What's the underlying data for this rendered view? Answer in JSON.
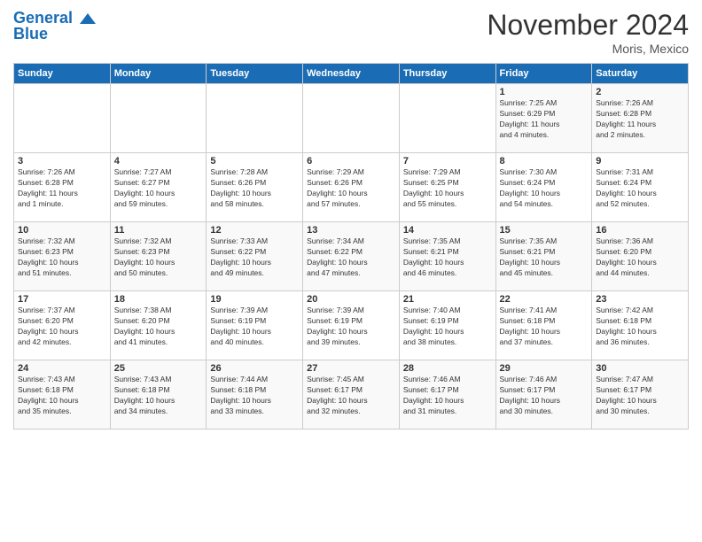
{
  "header": {
    "logo_line1": "General",
    "logo_line2": "Blue",
    "month": "November 2024",
    "location": "Moris, Mexico"
  },
  "days_of_week": [
    "Sunday",
    "Monday",
    "Tuesday",
    "Wednesday",
    "Thursday",
    "Friday",
    "Saturday"
  ],
  "weeks": [
    [
      {
        "num": "",
        "info": ""
      },
      {
        "num": "",
        "info": ""
      },
      {
        "num": "",
        "info": ""
      },
      {
        "num": "",
        "info": ""
      },
      {
        "num": "",
        "info": ""
      },
      {
        "num": "1",
        "info": "Sunrise: 7:25 AM\nSunset: 6:29 PM\nDaylight: 11 hours\nand 4 minutes."
      },
      {
        "num": "2",
        "info": "Sunrise: 7:26 AM\nSunset: 6:28 PM\nDaylight: 11 hours\nand 2 minutes."
      }
    ],
    [
      {
        "num": "3",
        "info": "Sunrise: 7:26 AM\nSunset: 6:28 PM\nDaylight: 11 hours\nand 1 minute."
      },
      {
        "num": "4",
        "info": "Sunrise: 7:27 AM\nSunset: 6:27 PM\nDaylight: 10 hours\nand 59 minutes."
      },
      {
        "num": "5",
        "info": "Sunrise: 7:28 AM\nSunset: 6:26 PM\nDaylight: 10 hours\nand 58 minutes."
      },
      {
        "num": "6",
        "info": "Sunrise: 7:29 AM\nSunset: 6:26 PM\nDaylight: 10 hours\nand 57 minutes."
      },
      {
        "num": "7",
        "info": "Sunrise: 7:29 AM\nSunset: 6:25 PM\nDaylight: 10 hours\nand 55 minutes."
      },
      {
        "num": "8",
        "info": "Sunrise: 7:30 AM\nSunset: 6:24 PM\nDaylight: 10 hours\nand 54 minutes."
      },
      {
        "num": "9",
        "info": "Sunrise: 7:31 AM\nSunset: 6:24 PM\nDaylight: 10 hours\nand 52 minutes."
      }
    ],
    [
      {
        "num": "10",
        "info": "Sunrise: 7:32 AM\nSunset: 6:23 PM\nDaylight: 10 hours\nand 51 minutes."
      },
      {
        "num": "11",
        "info": "Sunrise: 7:32 AM\nSunset: 6:23 PM\nDaylight: 10 hours\nand 50 minutes."
      },
      {
        "num": "12",
        "info": "Sunrise: 7:33 AM\nSunset: 6:22 PM\nDaylight: 10 hours\nand 49 minutes."
      },
      {
        "num": "13",
        "info": "Sunrise: 7:34 AM\nSunset: 6:22 PM\nDaylight: 10 hours\nand 47 minutes."
      },
      {
        "num": "14",
        "info": "Sunrise: 7:35 AM\nSunset: 6:21 PM\nDaylight: 10 hours\nand 46 minutes."
      },
      {
        "num": "15",
        "info": "Sunrise: 7:35 AM\nSunset: 6:21 PM\nDaylight: 10 hours\nand 45 minutes."
      },
      {
        "num": "16",
        "info": "Sunrise: 7:36 AM\nSunset: 6:20 PM\nDaylight: 10 hours\nand 44 minutes."
      }
    ],
    [
      {
        "num": "17",
        "info": "Sunrise: 7:37 AM\nSunset: 6:20 PM\nDaylight: 10 hours\nand 42 minutes."
      },
      {
        "num": "18",
        "info": "Sunrise: 7:38 AM\nSunset: 6:20 PM\nDaylight: 10 hours\nand 41 minutes."
      },
      {
        "num": "19",
        "info": "Sunrise: 7:39 AM\nSunset: 6:19 PM\nDaylight: 10 hours\nand 40 minutes."
      },
      {
        "num": "20",
        "info": "Sunrise: 7:39 AM\nSunset: 6:19 PM\nDaylight: 10 hours\nand 39 minutes."
      },
      {
        "num": "21",
        "info": "Sunrise: 7:40 AM\nSunset: 6:19 PM\nDaylight: 10 hours\nand 38 minutes."
      },
      {
        "num": "22",
        "info": "Sunrise: 7:41 AM\nSunset: 6:18 PM\nDaylight: 10 hours\nand 37 minutes."
      },
      {
        "num": "23",
        "info": "Sunrise: 7:42 AM\nSunset: 6:18 PM\nDaylight: 10 hours\nand 36 minutes."
      }
    ],
    [
      {
        "num": "24",
        "info": "Sunrise: 7:43 AM\nSunset: 6:18 PM\nDaylight: 10 hours\nand 35 minutes."
      },
      {
        "num": "25",
        "info": "Sunrise: 7:43 AM\nSunset: 6:18 PM\nDaylight: 10 hours\nand 34 minutes."
      },
      {
        "num": "26",
        "info": "Sunrise: 7:44 AM\nSunset: 6:18 PM\nDaylight: 10 hours\nand 33 minutes."
      },
      {
        "num": "27",
        "info": "Sunrise: 7:45 AM\nSunset: 6:17 PM\nDaylight: 10 hours\nand 32 minutes."
      },
      {
        "num": "28",
        "info": "Sunrise: 7:46 AM\nSunset: 6:17 PM\nDaylight: 10 hours\nand 31 minutes."
      },
      {
        "num": "29",
        "info": "Sunrise: 7:46 AM\nSunset: 6:17 PM\nDaylight: 10 hours\nand 30 minutes."
      },
      {
        "num": "30",
        "info": "Sunrise: 7:47 AM\nSunset: 6:17 PM\nDaylight: 10 hours\nand 30 minutes."
      }
    ]
  ]
}
